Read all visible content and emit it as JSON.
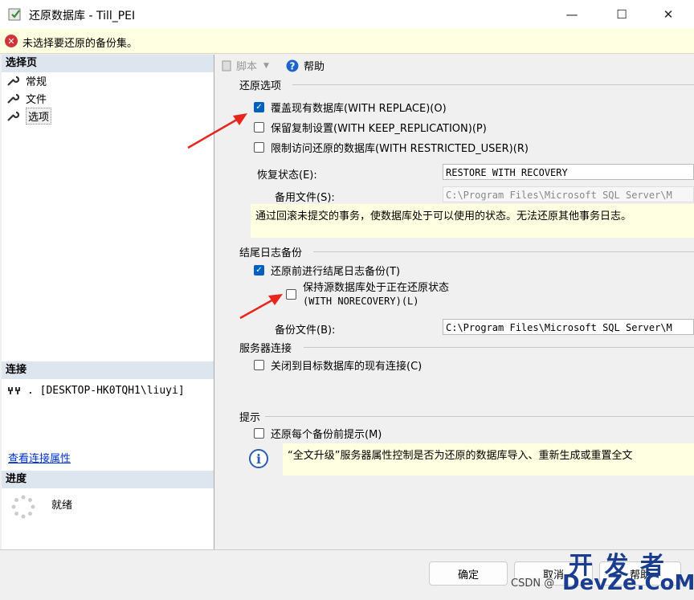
{
  "window": {
    "title": "还原数据库 - Till_PEI"
  },
  "error_bar": {
    "message": "未选择要还原的备份集。"
  },
  "left": {
    "select_page_header": "选择页",
    "pages": [
      {
        "label": "常规"
      },
      {
        "label": "文件"
      },
      {
        "label": "选项"
      }
    ],
    "connection_header": "连接",
    "connection_value": ". [DESKTOP-HK0TQH1\\liuyi]",
    "view_connection_link": "查看连接属性",
    "progress_header": "进度",
    "progress_status": "就绪"
  },
  "toolbar": {
    "script_label": "脚本",
    "help_label": "帮助"
  },
  "restore_options": {
    "title": "还原选项",
    "overwrite": "覆盖现有数据库(WITH REPLACE)(O)",
    "keep_replication": "保留复制设置(WITH KEEP_REPLICATION)(P)",
    "restrict_access": "限制访问还原的数据库(WITH RESTRICTED_USER)(R)",
    "recovery_state_label": "恢复状态(E):",
    "recovery_state_value": "RESTORE WITH RECOVERY",
    "standby_file_label": "备用文件(S):",
    "standby_file_value": "C:\\Program Files\\Microsoft SQL Server\\M",
    "recovery_note": "通过回滚未提交的事务，使数据库处于可以使用的状态。无法还原其他事务日志。"
  },
  "tail_log": {
    "title": "结尾日志备份",
    "take_tail_log": "还原前进行结尾日志备份(T)",
    "leave_restoring_line1": "保持源数据库处于正在还原状态",
    "leave_restoring_line2": "(WITH NORECOVERY)(L)",
    "backup_file_label": "备份文件(B):",
    "backup_file_value": "C:\\Program Files\\Microsoft SQL Server\\M"
  },
  "server_connections": {
    "title": "服务器连接",
    "close_connections": "关闭到目标数据库的现有连接(C)"
  },
  "prompt": {
    "title": "提示",
    "prompt_before_each": "还原每个备份前提示(M)",
    "info_text": "“全文升级”服务器属性控制是否为还原的数据库导入、重新生成或重置全文"
  },
  "footer": {
    "ok": "确定",
    "cancel": "取消",
    "help": "帮助"
  },
  "watermark": {
    "csdn": "CSDN @",
    "brand_top": "开 发 者",
    "brand_bottom": "DevZe.CoM"
  },
  "colors": {
    "accent": "#0060c0",
    "error": "#d13438",
    "arrow": "#e8251c",
    "info_bg": "#ffffe1"
  }
}
